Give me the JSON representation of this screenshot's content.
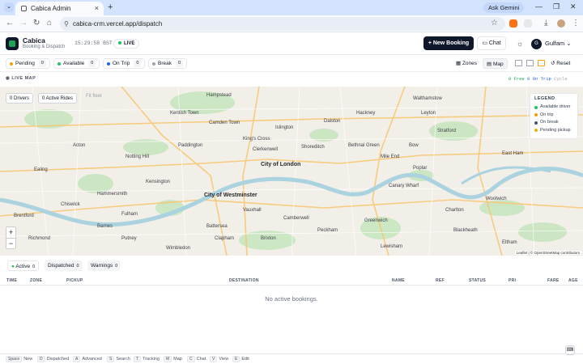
{
  "browser": {
    "tab_title": "Cabica Admin",
    "url": "cabica-crm.vercel.app/dispatch",
    "gemini_label": "Ask Gemini"
  },
  "header": {
    "brand": "Cabica",
    "brand_sub": "Booking & Dispatch",
    "clock": "15:29:58 BST",
    "live_label": "LIVE",
    "new_booking": "+ New Booking",
    "chat": "Chat",
    "user_initial": "G",
    "user_name": "Gulfam"
  },
  "status": {
    "filters": [
      {
        "label": "Pending",
        "count": "0",
        "color": "#f59e0b"
      },
      {
        "label": "Available",
        "count": "0",
        "color": "#22c55e"
      },
      {
        "label": "On Trip",
        "count": "0",
        "color": "#2563eb"
      },
      {
        "label": "Break",
        "count": "0",
        "color": "#9ca3af"
      }
    ],
    "zones": "Zones",
    "map": "Map",
    "reset": "Reset"
  },
  "map": {
    "section_label": "LIVE MAP",
    "free_text": "0 Free",
    "ontrip_text": "0 On Trip",
    "cycle_text": "Cycle",
    "drivers_chip": "0 Drivers",
    "rides_chip": "0 Active Rides",
    "fit_label": "Fit fleet",
    "zoom_in": "+",
    "zoom_out": "−",
    "legend_title": "LEGEND",
    "legend": [
      {
        "label": "Available driver",
        "color": "#22c55e"
      },
      {
        "label": "On trip",
        "color": "#f59e0b"
      },
      {
        "label": "On break",
        "color": "#475569"
      },
      {
        "label": "Pending pickup",
        "color": "#eab308"
      }
    ],
    "attribution": "Leaflet | © OpenStreetMap contributors",
    "places": [
      "Hampstead",
      "Camden Town",
      "Islington",
      "Dalston",
      "Hackney",
      "Stratford",
      "Paddington",
      "King's Cross",
      "Clerkenwell",
      "City of London",
      "Shoreditch",
      "Bethnal Green",
      "Mile End",
      "Notting Hill",
      "Ealing",
      "Chiswick",
      "Kensington",
      "City of Westminster",
      "Canary Wharf",
      "Greenwich",
      "Battersea",
      "Brixton",
      "Peckham",
      "Lewisham",
      "Wimbledon",
      "Brentford",
      "Putney",
      "Woolwich",
      "Bow",
      "Poplar",
      "Hammersmith",
      "Fulham",
      "Vauxhall",
      "Camberwell",
      "Clapham",
      "Blackheath",
      "Eltham",
      "Walthamstow",
      "Leyton",
      "East Ham",
      "Charlton",
      "Barnes",
      "Richmond",
      "Acton",
      "Kentish Town"
    ]
  },
  "bookings": {
    "tabs": [
      {
        "label": "Active",
        "count": "0"
      },
      {
        "label": "Dispatched",
        "count": "0"
      },
      {
        "label": "Warnings",
        "count": "0"
      }
    ],
    "columns": [
      "TIME",
      "ZONE",
      "PICKUP",
      "DESTINATION",
      "NAME",
      "REF",
      "STATUS",
      "PRI",
      "FARE",
      "AGE"
    ],
    "empty": "No active bookings."
  },
  "shortcuts": [
    {
      "key": "Space",
      "label": "New"
    },
    {
      "key": "D",
      "label": "Dispatched"
    },
    {
      "key": "A",
      "label": "Advanced"
    },
    {
      "key": "S",
      "label": "Search"
    },
    {
      "key": "T",
      "label": "Tracking"
    },
    {
      "key": "M",
      "label": "Map"
    },
    {
      "key": "C",
      "label": "Chat"
    },
    {
      "key": "V",
      "label": "View"
    },
    {
      "key": "E",
      "label": "Edit"
    }
  ]
}
